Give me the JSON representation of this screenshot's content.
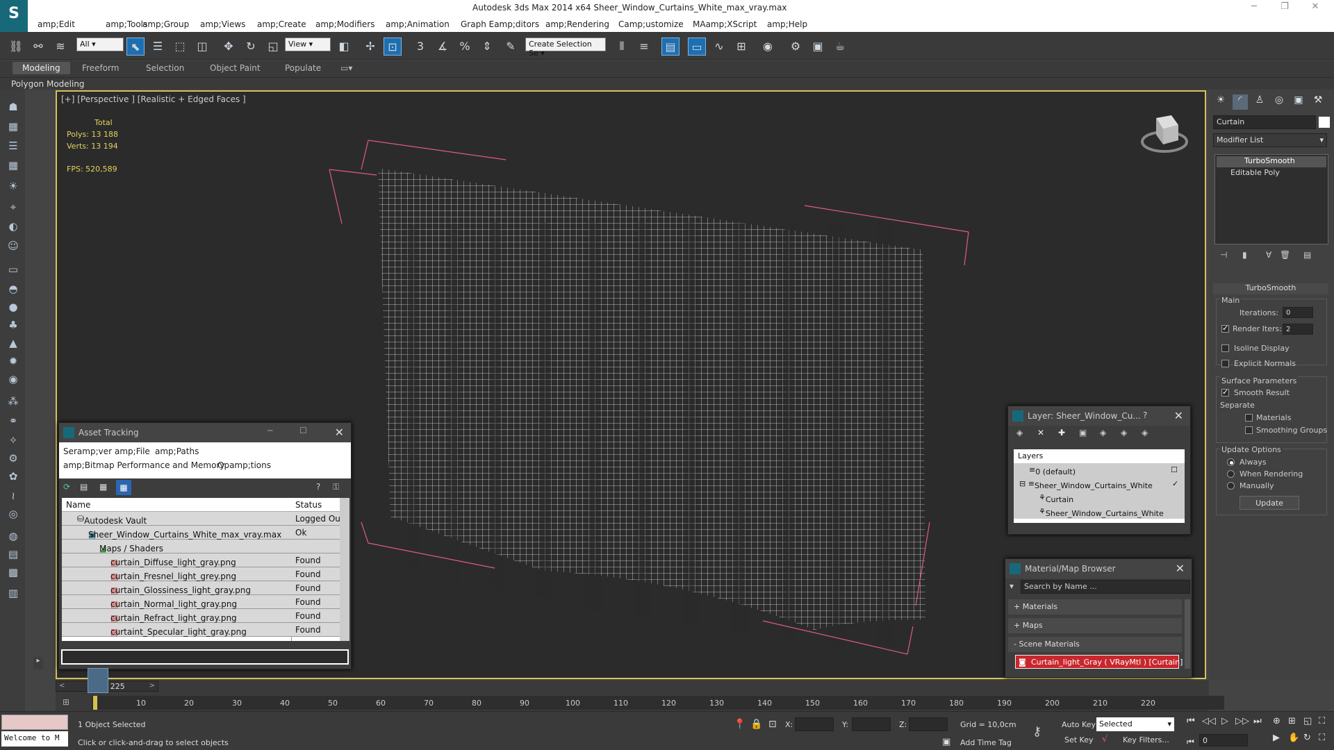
{
  "titlebar": {
    "logo_glyph": "S",
    "app_title": "Autodesk 3ds Max  2014 x64     Sheer_Window_Curtains_White_max_vray.max",
    "minimize_glyph": "─",
    "restore_glyph": "❐",
    "close_glyph": "✕"
  },
  "menu": [
    "amp;Edit",
    "amp;Tools",
    "amp;Group",
    "amp;Views",
    "amp;Create",
    "amp;Modifiers",
    "amp;Animation",
    "Graph Eamp;ditors",
    "amp;Rendering",
    "Camp;ustomize",
    "MAamp;XScript",
    "amp;Help"
  ],
  "toolbar": {
    "filter_value": "All",
    "refcoord_value": "View",
    "selection_set_placeholder": "Create Selection Se"
  },
  "ribbon": {
    "tabs": [
      "Modeling",
      "Freeform",
      "Selection",
      "Object Paint",
      "Populate"
    ],
    "sub_label": "Polygon Modeling"
  },
  "viewport": {
    "label": "[+] [Perspective ] [Realistic + Edged Faces ]",
    "stats": {
      "total_label": "Total",
      "polys_label": "Polys:",
      "polys_value": "13 188",
      "verts_label": "Verts:",
      "verts_value": "13 194",
      "fps_label": "FPS:",
      "fps_value": "520,589"
    }
  },
  "command_panel": {
    "object_name": "Curtain",
    "modifier_list_label": "Modifier List",
    "stack": [
      "TurboSmooth",
      "Editable Poly"
    ],
    "rollout_title": "TurboSmooth",
    "main_label": "Main",
    "iterations_label": "Iterations:",
    "iterations_value": "0",
    "render_iters_label": "Render Iters:",
    "render_iters_value": "2",
    "isoline_label": "Isoline Display",
    "explicit_normals_label": "Explicit Normals",
    "surface_params_label": "Surface Parameters",
    "smooth_result_label": "Smooth Result",
    "separate_label": "Separate",
    "materials_label": "Materials",
    "smoothing_groups_label": "Smoothing Groups",
    "update_options_label": "Update Options",
    "always_label": "Always",
    "when_rendering_label": "When Rendering",
    "manually_label": "Manually",
    "update_button": "Update"
  },
  "asset_tracking": {
    "title": "Asset Tracking",
    "menu": [
      "Seramp;ver",
      "amp;File",
      "amp;Paths",
      "amp;Bitmap Performance and Memory",
      "Opamp;tions"
    ],
    "col_name": "Name",
    "col_status": "Status",
    "rows": [
      {
        "name": "Autodesk Vault",
        "status": "Logged Out"
      },
      {
        "name": "Sheer_Window_Curtains_White_max_vray.max",
        "status": "Ok"
      },
      {
        "name": "Maps / Shaders",
        "status": ""
      },
      {
        "name": "curtain_Diffuse_light_gray.png",
        "status": "Found"
      },
      {
        "name": "curtain_Fresnel_light_grey.png",
        "status": "Found"
      },
      {
        "name": "curtain_Glossiness_light_gray.png",
        "status": "Found"
      },
      {
        "name": "curtain_Normal_light_gray.png",
        "status": "Found"
      },
      {
        "name": "curtain_Refract_light_gray.png",
        "status": "Found"
      },
      {
        "name": "curtaint_Specular_light_gray.png",
        "status": "Found"
      }
    ]
  },
  "layer_window": {
    "title": "Layer: Sheer_Window_Cu...",
    "help": "?",
    "header": "Layers",
    "items": [
      "0 (default)",
      "Sheer_Window_Curtains_White",
      "Curtain",
      "Sheer_Window_Curtains_White"
    ]
  },
  "material_browser": {
    "title": "Material/Map Browser",
    "search_placeholder": "Search by Name ...",
    "sections": [
      "+ Materials",
      "+ Maps",
      "- Scene Materials"
    ],
    "scene_material": "Curtain_light_Gray  ( VRayMtl )  [Curtain]"
  },
  "timeline": {
    "frame_counter": "0 / 225",
    "ticks": [
      "10",
      "20",
      "30",
      "40",
      "50",
      "60",
      "70",
      "80",
      "90",
      "100",
      "110",
      "120",
      "130",
      "140",
      "150",
      "160",
      "170",
      "180",
      "190",
      "200",
      "210",
      "220"
    ]
  },
  "statusbar": {
    "maxscript_text": "Welcome to M",
    "selection_status": "1 Object Selected",
    "prompt": "Click or click-and-drag to select objects",
    "x_label": "X:",
    "y_label": "Y:",
    "z_label": "Z:",
    "grid": "Grid = 10,0cm",
    "add_time_tag": "Add Time Tag",
    "auto_key": "Auto Key",
    "set_key": "Set Key",
    "key_mode_value": "Selected",
    "key_filters": "Key Filters...",
    "frame_value": "0"
  }
}
